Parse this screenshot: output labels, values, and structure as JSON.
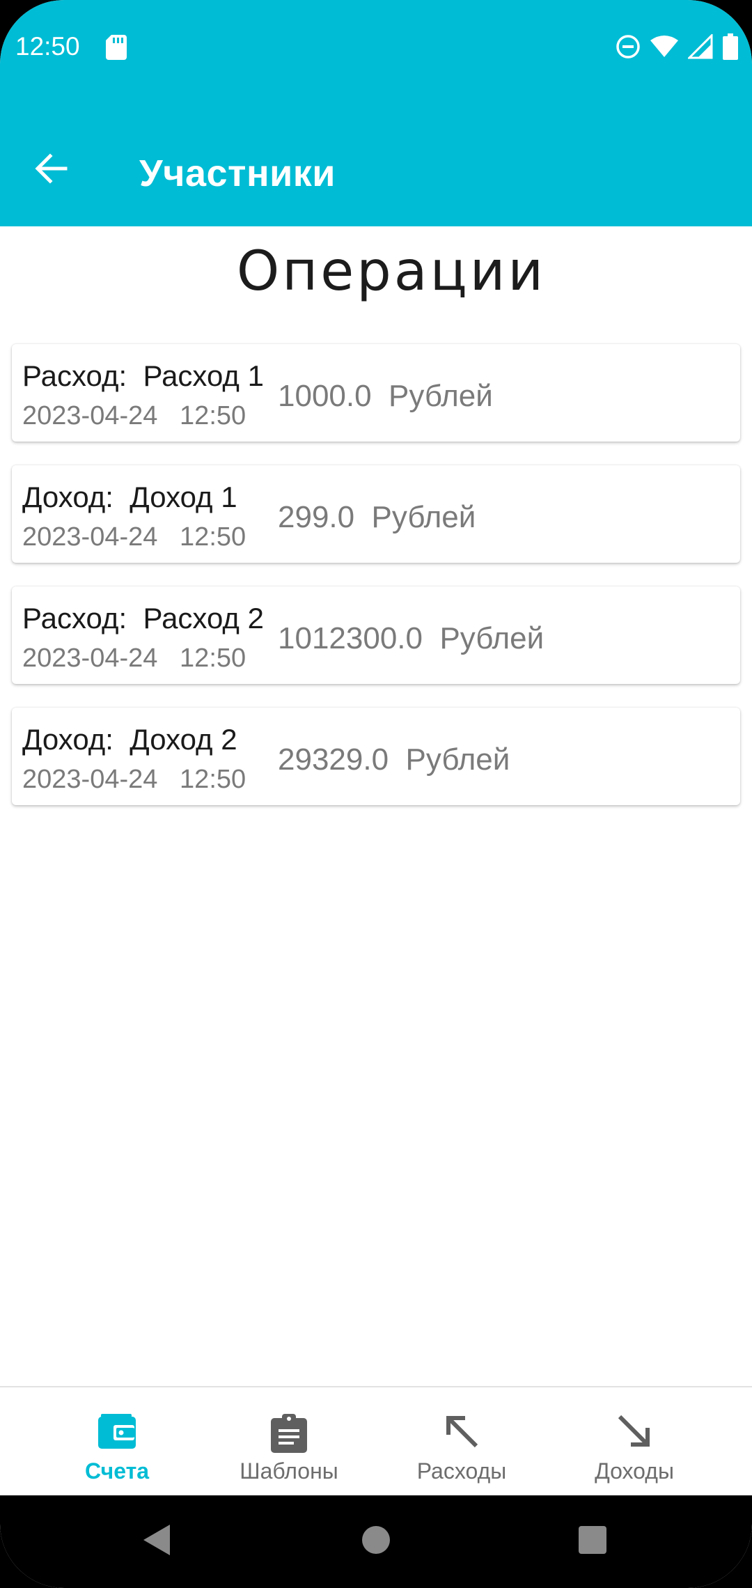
{
  "status_bar": {
    "time": "12:50"
  },
  "app_bar": {
    "title": "Участники"
  },
  "main": {
    "section_title": "Операции",
    "operations": [
      {
        "title": "Расход:  Расход 1",
        "date": "2023-04-24   12:50",
        "amount": "1000.0  Рублей"
      },
      {
        "title": "Доход:  Доход 1",
        "date": "2023-04-24   12:50",
        "amount": "299.0  Рублей"
      },
      {
        "title": "Расход:  Расход 2",
        "date": "2023-04-24   12:50",
        "amount": "1012300.0  Рублей"
      },
      {
        "title": "Доход:  Доход 2",
        "date": "2023-04-24   12:50",
        "amount": "29329.0  Рублей"
      }
    ]
  },
  "bottom_nav": {
    "items": [
      {
        "label": "Счета",
        "icon": "wallet-icon",
        "active": true
      },
      {
        "label": "Шаблоны",
        "icon": "clipboard-icon",
        "active": false
      },
      {
        "label": "Расходы",
        "icon": "arrow-up-left-icon",
        "active": false
      },
      {
        "label": "Доходы",
        "icon": "arrow-down-right-icon",
        "active": false
      }
    ]
  },
  "colors": {
    "accent": "#00BCD4",
    "text_primary": "#1a1a1a",
    "text_secondary": "#7a7a7a"
  }
}
